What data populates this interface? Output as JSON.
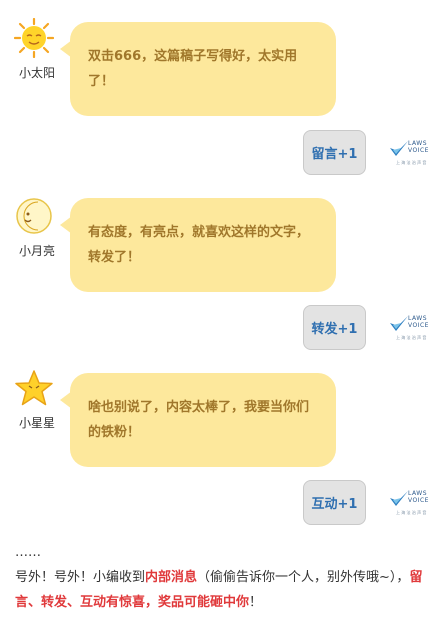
{
  "messages": [
    {
      "name": "小太阳",
      "avatar_icon": "sun-icon",
      "text": "双击666，这篇稿子写得好，太实用了！",
      "reply": "留言+1"
    },
    {
      "name": "小月亮",
      "avatar_icon": "moon-icon",
      "text": "有态度，有亮点，就喜欢这样的文字，转发了！",
      "reply": "转发+1"
    },
    {
      "name": "小星星",
      "avatar_icon": "star-icon",
      "text": "啥也别说了，内容太棒了，我要当你们的铁粉！",
      "reply": "互动+1"
    }
  ],
  "logo": {
    "line1": "LAWS",
    "line2": "VOICE",
    "sub": "上 海 法 治 声 音"
  },
  "footer": {
    "ellipsis": "……",
    "p1": "号外！号外！小编收到",
    "p2": "内部消息",
    "p3": "（偷偷告诉你一个人，别外传哦~），",
    "p4": "留言、转发、互动有惊喜，奖品可能砸中你",
    "p5": "！"
  },
  "colors": {
    "bubble": "#fde89c",
    "bubble_text": "#a0772b",
    "reply_text": "#2f6fb0",
    "highlight": "#e0393b"
  }
}
